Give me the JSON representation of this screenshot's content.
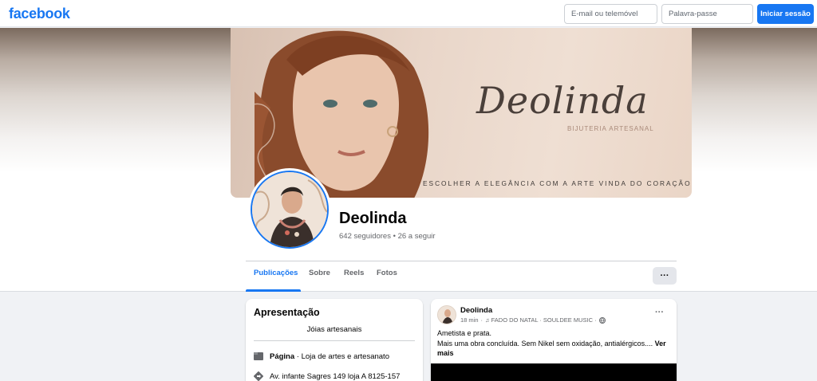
{
  "topbar": {
    "logo": "facebook",
    "email_placeholder": "E-mail ou telemóvel",
    "password_placeholder": "Palavra-passe",
    "login_label": "Iniciar sessão",
    "accent": "#1877f2"
  },
  "cover": {
    "brand": "Deolinda",
    "sub": "BIJUTERIA ARTESANAL",
    "tagline": "ESCOLHER A ELEGÂNCIA COM A ARTE VINDA DO CORAÇÃO"
  },
  "profile": {
    "name": "Deolinda",
    "followers": "642 seguidores • 26 a seguir"
  },
  "tabs": [
    {
      "label": "Publicações",
      "active": true
    },
    {
      "label": "Sobre",
      "active": false
    },
    {
      "label": "Reels",
      "active": false
    },
    {
      "label": "Fotos",
      "active": false
    }
  ],
  "more_label": "···",
  "intro": {
    "title": "Apresentação",
    "bio": "Jóias artesanais",
    "page_type_bold": "Página",
    "page_type_rest": " · Loja de artes e artesanato",
    "address": "Av. infante Sagres 149 loja A 8125-157",
    "icons": [
      "flag-icon",
      "directions-icon"
    ]
  },
  "post": {
    "author": "Deolinda",
    "time": "18 min",
    "music": "FADO DO NATAL · SOULDEE MUSIC ·",
    "line1": "Ametista e prata.",
    "line2": "Mais uma obra concluída. Sem Nikel sem oxidação, antialérgicos....",
    "see_more": "Ver mais",
    "icons": [
      "music-note-icon",
      "globe-icon"
    ]
  }
}
